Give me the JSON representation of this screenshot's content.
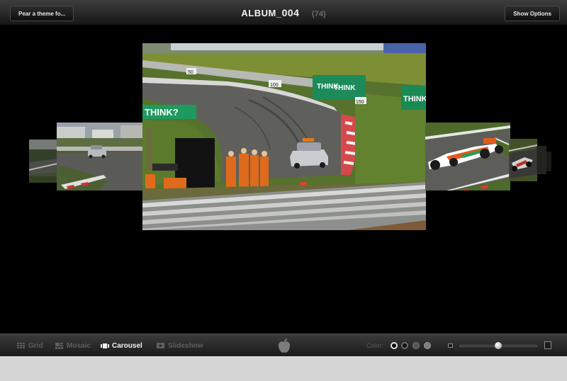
{
  "header": {
    "theme_button": "Pear a theme fo...",
    "album_name_prefix": "ALBUM_",
    "album_name_number": "004",
    "album_count": "(74)",
    "options_button": "Show Options"
  },
  "views": {
    "grid": "Grid",
    "mosaic": "Mosaic",
    "carousel": "Carousel",
    "slideshow": "Slideshow",
    "active": "Carousel"
  },
  "photo_main": {
    "sign_think_left": "THINK?",
    "sign_think_mid": "THINK",
    "sign_think_mid2": "THINK",
    "sign_think_right": "THINK:",
    "marker_50": "50",
    "marker_100": "100",
    "marker_150": "150"
  },
  "color": {
    "label": "Color:",
    "options": [
      "#000000",
      "#111111",
      "#555555",
      "#7d7d7d"
    ],
    "selected": "#000000"
  },
  "thumbnail_size": {
    "value": 0.5
  }
}
